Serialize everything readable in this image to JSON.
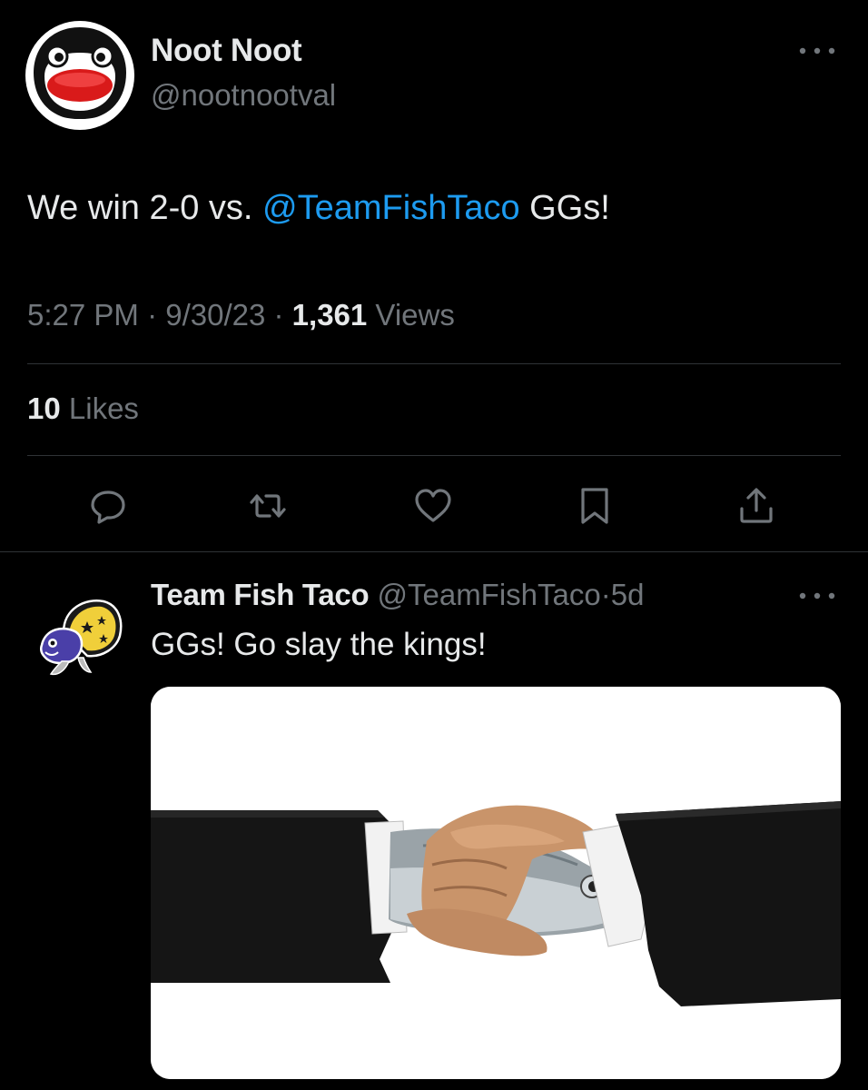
{
  "tweet": {
    "author_name": "Noot Noot",
    "author_handle": "@nootnootval",
    "text_before": "We win 2-0 vs. ",
    "mention": "@TeamFishTaco",
    "text_after": " GGs!",
    "time": "5:27 PM",
    "separator": " · ",
    "date": "9/30/23",
    "views_count": "1,361",
    "views_label": " Views",
    "likes_count": "10",
    "likes_label": " Likes"
  },
  "actions": {
    "reply_icon": "reply-icon",
    "retweet_icon": "retweet-icon",
    "like_icon": "heart-icon",
    "bookmark_icon": "bookmark-icon",
    "share_icon": "share-icon"
  },
  "reply": {
    "author_name": "Team Fish Taco",
    "author_handle": "@TeamFishTaco",
    "separator": "·",
    "age": "5d",
    "text": "GGs! Go slay the kings!",
    "media_icon": "handshake-fish-image"
  },
  "colors": {
    "background": "#000000",
    "text_primary": "#e7e9ea",
    "text_secondary": "#71767b",
    "accent_link": "#1d9bf0",
    "divider": "#2f3336"
  }
}
